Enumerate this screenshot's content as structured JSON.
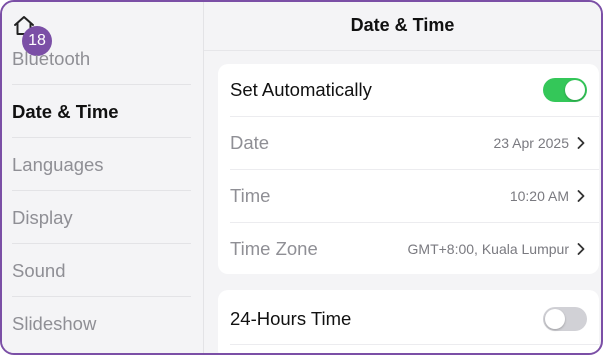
{
  "nav": {
    "badge": "18",
    "home_icon": "home-icon"
  },
  "sidebar": {
    "items": [
      {
        "label": "Bluetooth"
      },
      {
        "label": "Date & Time",
        "active": true
      },
      {
        "label": "Languages"
      },
      {
        "label": "Display"
      },
      {
        "label": "Sound"
      },
      {
        "label": "Slideshow"
      }
    ]
  },
  "header": {
    "title": "Date & Time"
  },
  "settings": {
    "set_automatically": {
      "label": "Set Automatically",
      "enabled": true
    },
    "date": {
      "label": "Date",
      "value": "23 Apr 2025"
    },
    "time": {
      "label": "Time",
      "value": "10:20 AM"
    },
    "time_zone": {
      "label": "Time Zone",
      "value": "GMT+8:00, Kuala Lumpur"
    },
    "hours_24": {
      "label": "24-Hours Time",
      "enabled": false
    }
  },
  "colors": {
    "accent": "#7b4fa6",
    "toggle_on": "#34c759",
    "toggle_off": "#d1d1d6",
    "muted_text": "#8f8f95"
  }
}
